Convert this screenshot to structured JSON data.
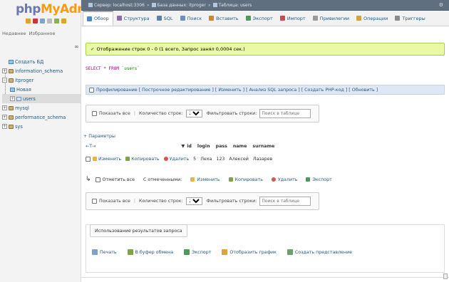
{
  "logo": {
    "part1": "php",
    "part2": "MyAdmin"
  },
  "nav": {
    "tabs": [
      "Недавнее",
      "Избранное"
    ],
    "collapse_symbol": "∞",
    "tree": [
      {
        "label": "Создать БД",
        "type": "new",
        "level": 0
      },
      {
        "label": "information_schema",
        "type": "db",
        "level": 0
      },
      {
        "label": "itproger",
        "type": "db",
        "level": 0
      },
      {
        "label": "Новая",
        "type": "new",
        "level": 1
      },
      {
        "label": "users",
        "type": "table",
        "level": 1,
        "selected": true
      },
      {
        "label": "mysql",
        "type": "db",
        "level": 0
      },
      {
        "label": "performance_schema",
        "type": "db",
        "level": 0
      },
      {
        "label": "sys",
        "type": "db",
        "level": 0
      }
    ]
  },
  "breadcrumb": {
    "server": "Сервер: localhost:3306",
    "database": "База данных: itproger",
    "table": "Таблица: users"
  },
  "tabs": [
    {
      "label": "Обзор",
      "active": true,
      "color": "#4b8ac9"
    },
    {
      "label": "Структура",
      "color": "#8c6bb1"
    },
    {
      "label": "SQL",
      "color": "#5f7fa6"
    },
    {
      "label": "Поиск",
      "color": "#6a8fc0"
    },
    {
      "label": "Вставить",
      "color": "#c68b2a"
    },
    {
      "label": "Экспорт",
      "color": "#4f9a5a"
    },
    {
      "label": "Импорт",
      "color": "#c24f4f"
    },
    {
      "label": "Привилегии",
      "color": "#9a9a9a"
    },
    {
      "label": "Операции",
      "color": "#d4a23a"
    },
    {
      "label": "Триггеры",
      "color": "#8a8a8a"
    }
  ],
  "message": "Отображение строк 0 - 0 (1 всего, Запрос занял 0,0004 сек.)",
  "query": {
    "keyword": "SELECT * FROM",
    "table": "`users`"
  },
  "profiling": "Профилирование [ Построчное редактирование ] [ Изменить ] [ Анализ SQL запроса ] [ Создать PHP-код ] [ Обновить ]",
  "navigation": {
    "show_all": "Показать все",
    "row_count_label": "Количество строк:",
    "row_count_value": "25",
    "filter_label": "Фильтровать строки:",
    "filter_placeholder": "Поиск в таблице"
  },
  "params_link": "+ Параметры",
  "columns": {
    "arrows": "←T→",
    "sort": "▼",
    "names": [
      "id",
      "login",
      "pass",
      "name",
      "surname"
    ]
  },
  "row": {
    "actions": [
      "Изменить",
      "Копировать",
      "Удалить"
    ],
    "cells": [
      "5",
      "Леха",
      "123",
      "Алексей",
      "Лазарев"
    ]
  },
  "bulk": {
    "check_all": "Отметить все",
    "with_selected": "С отмеченными:",
    "edit": "Изменить",
    "copy": "Копировать",
    "delete": "Удалить",
    "export": "Экспорт"
  },
  "usage": {
    "legend": "Использование результатов запроса",
    "actions": [
      "Печать",
      "В буфер обмена",
      "Экспорт",
      "Отобразить график",
      "Создать представление"
    ]
  }
}
